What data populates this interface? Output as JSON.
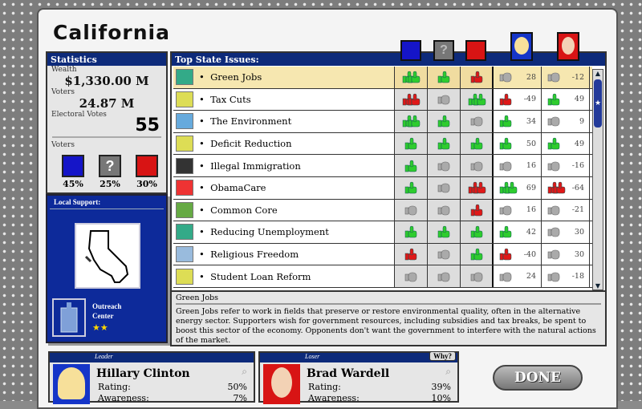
{
  "state": "California",
  "statistics": {
    "title": "Statistics",
    "wealth_label": "Wealth",
    "wealth": "$1,330.00 M",
    "voters_label": "Voters",
    "voters": "24.87 M",
    "electoral_label": "Electoral Votes",
    "electoral": "55",
    "breakdown_label": "Voters",
    "parties": [
      {
        "name": "democrat",
        "pct": "45%",
        "color": "#1515c8",
        "glyph": "D"
      },
      {
        "name": "undecided",
        "pct": "25%",
        "color": "#777777",
        "glyph": "?"
      },
      {
        "name": "republican",
        "pct": "30%",
        "color": "#d81414",
        "glyph": "R"
      }
    ]
  },
  "local_support": {
    "title": "Local Support:",
    "building": "Outreach Center",
    "stars": "★★"
  },
  "issues": {
    "title": "Top State Issues:",
    "rows": [
      {
        "name": "Green Jobs",
        "d": "up2",
        "u": "up",
        "r": "down",
        "h": "neutral",
        "hv": "28",
        "b": "neutral",
        "bv": "-12",
        "color": "#3a8"
      },
      {
        "name": "Tax Cuts",
        "d": "down2",
        "u": "neutral",
        "r": "up2",
        "h": "down",
        "hv": "-49",
        "b": "up",
        "bv": "49",
        "color": "#dd5"
      },
      {
        "name": "The Environment",
        "d": "up2",
        "u": "up",
        "r": "neutral",
        "h": "up",
        "hv": "34",
        "b": "neutral",
        "bv": "9",
        "color": "#6ad"
      },
      {
        "name": "Deficit Reduction",
        "d": "up",
        "u": "up",
        "r": "up",
        "h": "up",
        "hv": "50",
        "b": "up",
        "bv": "49",
        "color": "#dd5"
      },
      {
        "name": "Illegal Immigration",
        "d": "up",
        "u": "neutral",
        "r": "neutral",
        "h": "neutral",
        "hv": "16",
        "b": "neutral",
        "bv": "-16",
        "color": "#333"
      },
      {
        "name": "ObamaCare",
        "d": "up",
        "u": "neutral",
        "r": "down2",
        "h": "up2",
        "hv": "69",
        "b": "down2",
        "bv": "-64",
        "color": "#e33"
      },
      {
        "name": "Common Core",
        "d": "neutral",
        "u": "neutral",
        "r": "down",
        "h": "neutral",
        "hv": "16",
        "b": "neutral",
        "bv": "-21",
        "color": "#6a4"
      },
      {
        "name": "Reducing Unemployment",
        "d": "up",
        "u": "up",
        "r": "up",
        "h": "up",
        "hv": "42",
        "b": "neutral",
        "bv": "30",
        "color": "#3a8"
      },
      {
        "name": "Religious Freedom",
        "d": "down",
        "u": "neutral",
        "r": "up",
        "h": "down",
        "hv": "-40",
        "b": "neutral",
        "bv": "30",
        "color": "#9bd"
      },
      {
        "name": "Student Loan Reform",
        "d": "neutral",
        "u": "neutral",
        "r": "neutral",
        "h": "neutral",
        "hv": "24",
        "b": "neutral",
        "bv": "-18",
        "color": "#dd5"
      }
    ]
  },
  "description": {
    "title": "Green Jobs",
    "text": "Green Jobs refer to work in fields that preserve or restore environmental quality, often in the alternative energy sector. Supporters wish for government resources, including subsidies and tax breaks, be spent to boost this sector of the economy. Opponents don't want the government to interfere with the natural actions of the market."
  },
  "leader": {
    "tag": "Leader",
    "name": "Hillary Clinton",
    "rating_label": "Rating:",
    "rating": "50%",
    "awareness_label": "Awareness:",
    "awareness": "7%"
  },
  "loser": {
    "tag": "Loser",
    "name": "Brad Wardell",
    "rating_label": "Rating:",
    "rating": "39%",
    "awareness_label": "Awareness:",
    "awareness": "10%",
    "why": "Why?"
  },
  "done": "DONE"
}
